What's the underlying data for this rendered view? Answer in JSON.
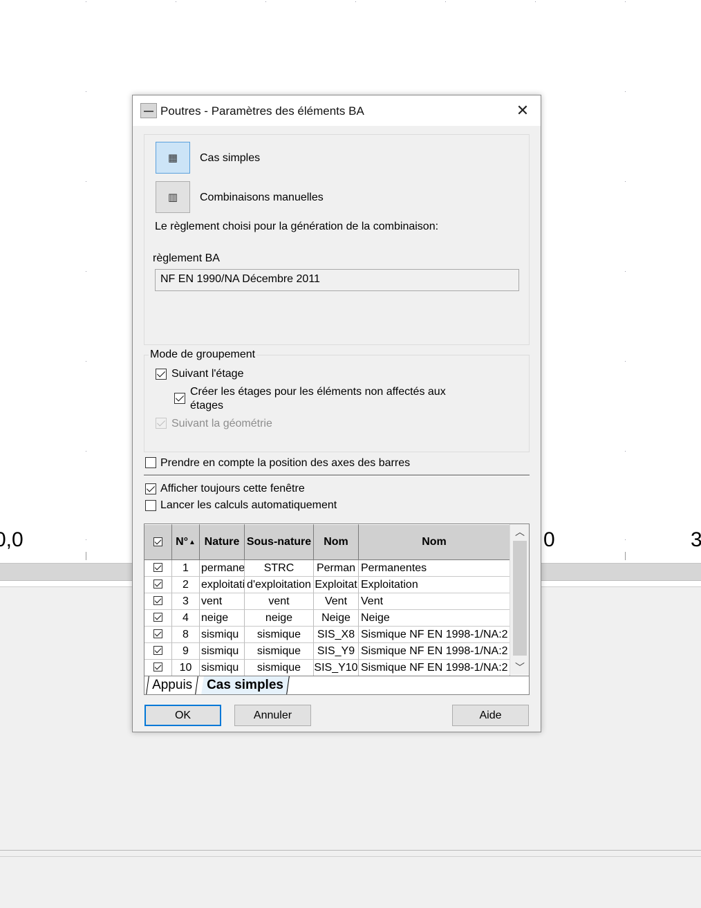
{
  "background": {
    "axis_labels": [
      "0,0",
      "0",
      "3"
    ]
  },
  "dialog": {
    "title": "Poutres - Paramètres des éléments BA",
    "close_label": "✕",
    "cases": {
      "simple_label": "Cas simples",
      "manual_label": "Combinaisons manuelles",
      "active": "simple"
    },
    "regulation_intro": "Le règlement choisi pour la génération de la combinaison:",
    "regulation_label": "règlement BA",
    "regulation_value": "NF EN 1990/NA Décembre 2011",
    "grouping": {
      "legend": "Mode de groupement",
      "by_floor_label": "Suivant l'étage",
      "by_floor_checked": true,
      "create_floors_label_line1": "Créer les étages pour les éléments non affectés aux",
      "create_floors_label_line2": "étages",
      "create_floors_checked": true,
      "by_geometry_label": "Suivant la géométrie",
      "by_geometry_checked": true,
      "by_geometry_enabled": false
    },
    "axis_position_label": "Prendre en compte la position des axes des barres",
    "axis_position_checked": false,
    "always_show_label": "Afficher toujours cette fenêtre",
    "always_show_checked": true,
    "auto_calc_label": "Lancer les calculs automatiquement",
    "auto_calc_checked": false,
    "table": {
      "headers": [
        "N°",
        "Nature",
        "Sous-nature",
        "Nom",
        "Nom"
      ],
      "rows": [
        {
          "num": "1",
          "nature": "permane",
          "sous": "STRC",
          "nom": "Perman",
          "nom2": "Permanentes"
        },
        {
          "num": "2",
          "nature": "exploitati",
          "sous": "d'exploitation",
          "nom": "Exploitat",
          "nom2": "Exploitation"
        },
        {
          "num": "3",
          "nature": "vent",
          "sous": "vent",
          "nom": "Vent",
          "nom2": "Vent"
        },
        {
          "num": "4",
          "nature": "neige",
          "sous": "neige",
          "nom": "Neige",
          "nom2": "Neige"
        },
        {
          "num": "8",
          "nature": "sismiqu",
          "sous": "sismique",
          "nom": "SIS_X8",
          "nom2": "Sismique NF EN 1998-1/NA:2"
        },
        {
          "num": "9",
          "nature": "sismiqu",
          "sous": "sismique",
          "nom": "SIS_Y9",
          "nom2": "Sismique NF EN 1998-1/NA:2"
        },
        {
          "num": "10",
          "nature": "sismiqu",
          "sous": "sismique",
          "nom": "SIS_Y10",
          "nom2": "Sismique NF EN 1998-1/NA:2"
        }
      ],
      "tabs": [
        "Appuis",
        "Cas simples"
      ],
      "active_tab": "Cas simples"
    },
    "buttons": {
      "ok": "OK",
      "cancel": "Annuler",
      "help": "Aide"
    }
  }
}
